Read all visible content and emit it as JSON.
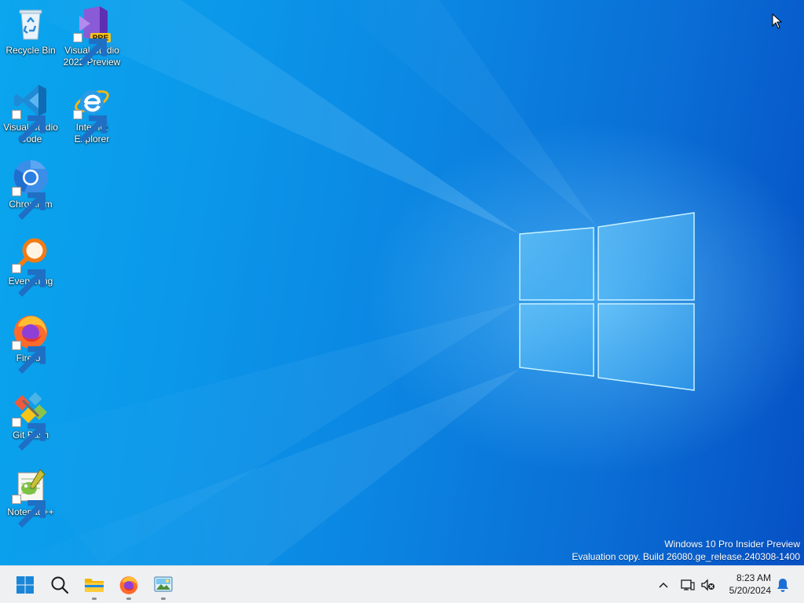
{
  "desktop": {
    "icons": [
      {
        "name": "recycle-bin",
        "label": "Recycle Bin"
      },
      {
        "name": "visual-studio-2022-preview",
        "label": "Visual Studio\n2022 Preview",
        "badge": "PRE"
      },
      {
        "name": "visual-studio-code",
        "label": "Visual Studio\nCode"
      },
      {
        "name": "internet-explorer",
        "label": "Internet\nExplorer"
      },
      {
        "name": "chromium",
        "label": "Chromium"
      },
      {
        "name": "everything",
        "label": "Everything"
      },
      {
        "name": "firefox",
        "label": "Firefox"
      },
      {
        "name": "git-bash",
        "label": "Git Bash"
      },
      {
        "name": "notepad-plus-plus",
        "label": "Notepad++"
      }
    ],
    "watermark": {
      "line1": "Windows 10 Pro Insider Preview",
      "line2": "Evaluation copy. Build 26080.ge_release.240308-1400"
    }
  },
  "taskbar": {
    "buttons": [
      {
        "name": "start",
        "icon": "windows-logo-icon"
      },
      {
        "name": "search",
        "icon": "search-icon"
      },
      {
        "name": "file-explorer",
        "icon": "folder-icon",
        "running": true
      },
      {
        "name": "firefox",
        "icon": "firefox-icon",
        "running": true
      },
      {
        "name": "image-viewer",
        "icon": "picture-icon",
        "running": true
      }
    ],
    "tray": {
      "icons": [
        "chevron-up-icon",
        "network-icon",
        "volume-muted-icon",
        "notification-bell-icon"
      ],
      "time": "8:23 AM",
      "date": "5/20/2024"
    }
  },
  "colors": {
    "accent": "#0078d4",
    "desktop_blue": "#0a86e2",
    "taskbar_bg": "#eef0f2"
  }
}
